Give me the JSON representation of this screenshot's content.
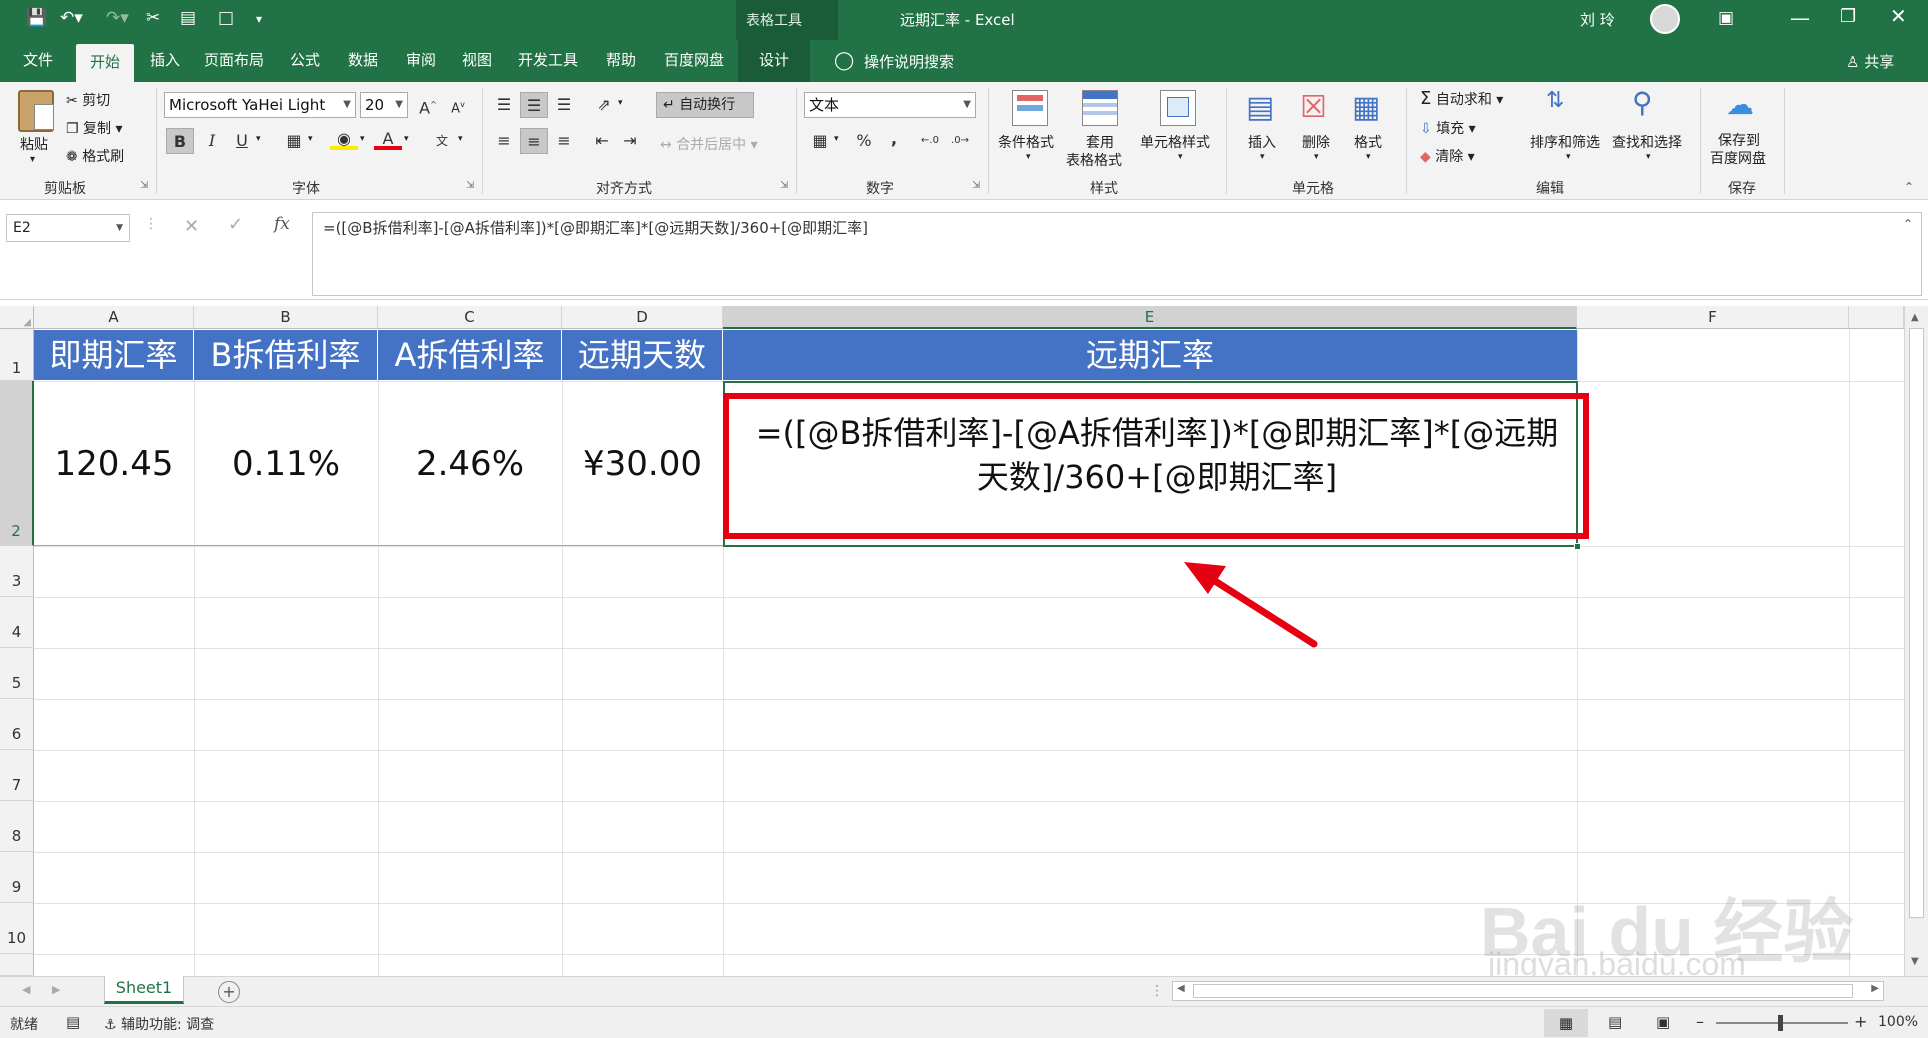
{
  "window": {
    "title": "远期汇率 - Excel",
    "context_tab": "表格工具",
    "user": "刘 玲"
  },
  "tabs": [
    {
      "label": "文件"
    },
    {
      "label": "开始"
    },
    {
      "label": "插入"
    },
    {
      "label": "页面布局"
    },
    {
      "label": "公式"
    },
    {
      "label": "数据"
    },
    {
      "label": "审阅"
    },
    {
      "label": "视图"
    },
    {
      "label": "开发工具"
    },
    {
      "label": "帮助"
    },
    {
      "label": "百度网盘"
    },
    {
      "label": "设计"
    }
  ],
  "tell_me": "操作说明搜索",
  "share": "共享",
  "ribbon": {
    "clipboard": {
      "paste": "粘贴",
      "cut": "剪切",
      "copy": "复制",
      "format_painter": "格式刷",
      "label": "剪贴板"
    },
    "font": {
      "name": "Microsoft YaHei Light",
      "size": "20",
      "label": "字体",
      "bold": "B",
      "italic": "I",
      "underline": "U",
      "grow": "A",
      "shrink": "A",
      "font_color": "A",
      "phonetic": "文"
    },
    "alignment": {
      "wrap": "自动换行",
      "merge": "合并后居中",
      "label": "对齐方式"
    },
    "number": {
      "format": "文本",
      "percent": "%",
      "comma": ",",
      "label": "数字"
    },
    "styles": {
      "conditional": "条件格式",
      "table_format_1": "套用",
      "table_format_2": "表格格式",
      "cell_styles": "单元格样式",
      "label": "样式"
    },
    "cells": {
      "insert": "插入",
      "delete": "删除",
      "format": "格式",
      "label": "单元格"
    },
    "editing": {
      "autosum": "自动求和",
      "fill": "填充",
      "clear": "清除",
      "sort": "排序和筛选",
      "find": "查找和选择",
      "label": "编辑"
    },
    "save": {
      "line1": "保存到",
      "line2": "百度网盘",
      "label": "保存"
    }
  },
  "formula_bar": {
    "name_box": "E2",
    "fx": "fx",
    "formula": "=([@B拆借利率]-[@A拆借利率])*[@即期汇率]*[@远期天数]/360+[@即期汇率]"
  },
  "columns": [
    "A",
    "B",
    "C",
    "D",
    "E",
    "F"
  ],
  "rows": [
    "1",
    "2",
    "3",
    "4",
    "5",
    "6",
    "7",
    "8",
    "9",
    "10"
  ],
  "table": {
    "headers": [
      "即期汇率",
      "B拆借利率",
      "A拆借利率",
      "远期天数",
      "远期汇率"
    ],
    "row": [
      "120.45",
      "0.11%",
      "2.46%",
      "¥30.00"
    ],
    "formula_line1": "=([@B拆借利率]-[@A拆借利率])*[@即期汇率]*[@远期",
    "formula_line2": "天数]/360+[@即期汇率]"
  },
  "sheet_tab": "Sheet1",
  "status": {
    "ready": "就绪",
    "accessibility": "辅助功能: 调查",
    "zoom": "100%"
  },
  "watermark": {
    "line1": "Bai du 经验",
    "line2": "jingyan.baidu.com"
  },
  "colors": {
    "excel_green": "#217346",
    "table_header": "#4472c4",
    "highlight": "#e60012"
  }
}
